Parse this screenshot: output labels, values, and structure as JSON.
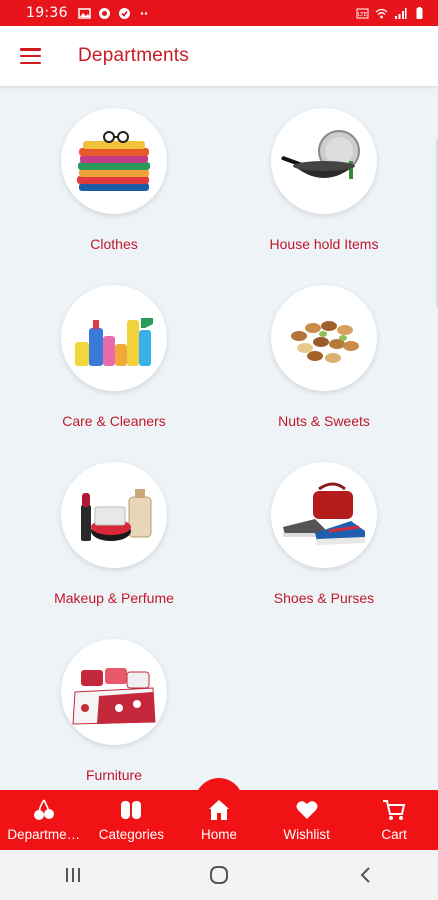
{
  "status_bar": {
    "time": "19:36"
  },
  "header": {
    "title": "Departments"
  },
  "departments": [
    {
      "label": "Clothes",
      "icon": "clothes-image"
    },
    {
      "label": "House hold Items",
      "icon": "wok-image"
    },
    {
      "label": "Care & Cleaners",
      "icon": "cleaners-image"
    },
    {
      "label": "Nuts & Sweets",
      "icon": "nuts-image"
    },
    {
      "label": "Makeup & Perfume",
      "icon": "makeup-image"
    },
    {
      "label": "Shoes & Purses",
      "icon": "shoes-image"
    },
    {
      "label": "Furniture",
      "icon": "bedding-image"
    }
  ],
  "bottom_nav": [
    {
      "label": "Departme…",
      "icon": "cherries-icon"
    },
    {
      "label": "Categories",
      "icon": "grid-icon"
    },
    {
      "label": "Home",
      "icon": "home-icon"
    },
    {
      "label": "Wishlist",
      "icon": "heart-icon"
    },
    {
      "label": "Cart",
      "icon": "cart-icon"
    }
  ],
  "colors": {
    "brand": "#e8141c",
    "label": "#c0182a",
    "background": "#eef3f8"
  }
}
